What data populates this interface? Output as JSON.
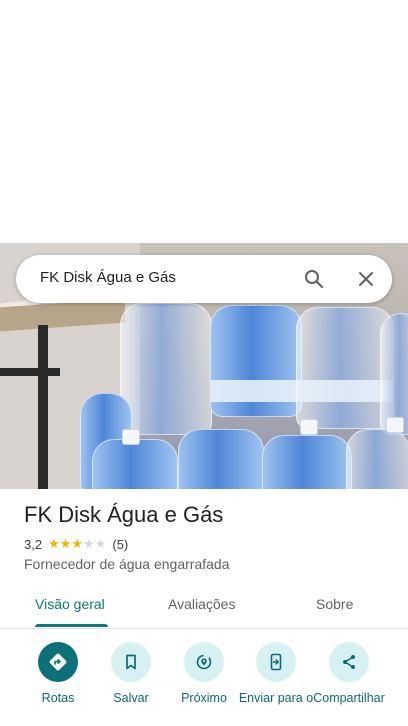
{
  "search": {
    "query": "FK Disk Água e Gás"
  },
  "place": {
    "name": "FK Disk Água e Gás",
    "rating": "3,2",
    "rating_value": 3.2,
    "reviews_count": "(5)",
    "category": "Fornecedor de água engarrafada"
  },
  "tabs": [
    {
      "label": "Visão geral",
      "active": true
    },
    {
      "label": "Avaliações",
      "active": false
    },
    {
      "label": "Sobre",
      "active": false
    }
  ],
  "actions": [
    {
      "label": "Rotas",
      "icon": "directions-icon"
    },
    {
      "label": "Salvar",
      "icon": "bookmark-icon"
    },
    {
      "label": "Próximo",
      "icon": "nearby-icon"
    },
    {
      "label": "Enviar para o",
      "icon": "send-to-phone-icon"
    },
    {
      "label": "Compartilhar",
      "icon": "share-icon"
    }
  ],
  "colors": {
    "accent": "#0b7a7a",
    "star": "#f4b400",
    "action_bg": "#d7f1f3"
  }
}
